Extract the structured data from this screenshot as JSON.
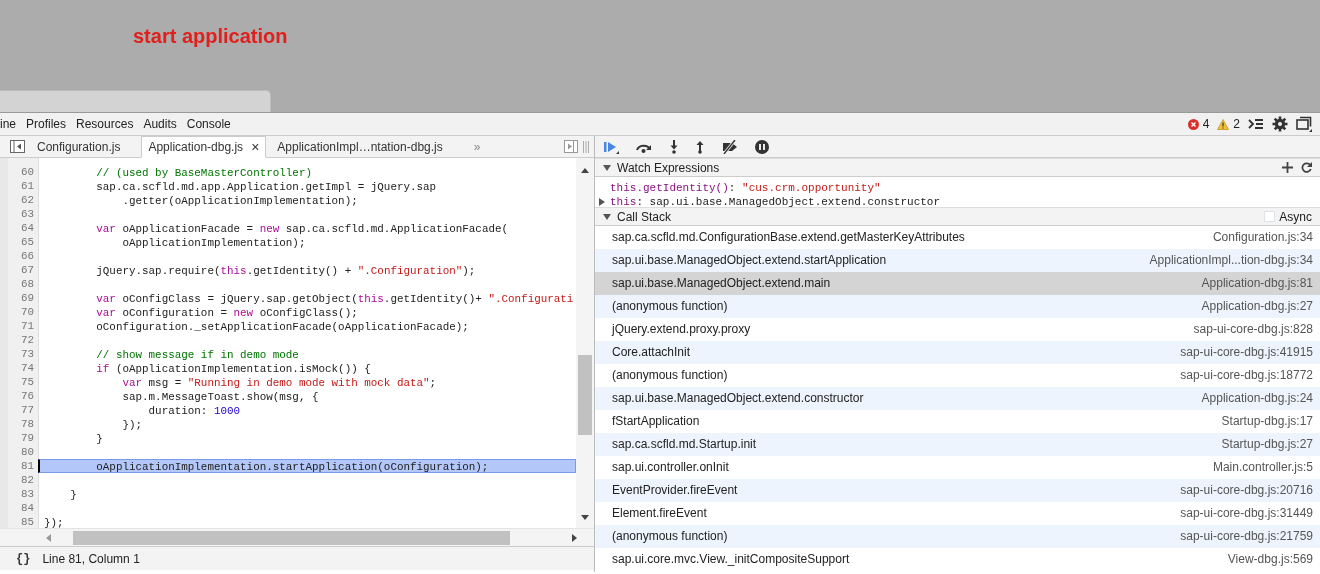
{
  "page": {
    "heading": "start application"
  },
  "devtools": {
    "panels": [
      {
        "label": "ine"
      },
      {
        "label": "Profiles"
      },
      {
        "label": "Resources"
      },
      {
        "label": "Audits"
      },
      {
        "label": "Console"
      }
    ],
    "error_count": "4",
    "warning_count": "2"
  },
  "sources": {
    "tabs": [
      {
        "label": "Configuration.js",
        "selected": false
      },
      {
        "label": "Application-dbg.js",
        "selected": true,
        "close": "×"
      },
      {
        "label": "ApplicationImpl…ntation-dbg.js",
        "selected": false
      }
    ],
    "more_tabs": "»",
    "lines": [
      {
        "number": "60",
        "highlighted": false,
        "tokens": [
          {
            "kind": "comment",
            "text": "        // (used by BaseMasterController)"
          }
        ]
      },
      {
        "number": "61",
        "highlighted": false,
        "tokens": [
          {
            "kind": "plain",
            "text": "        sap.ca.scfld.md.app.Application.getImpl = jQuery.sap"
          }
        ]
      },
      {
        "number": "62",
        "highlighted": false,
        "tokens": [
          {
            "kind": "plain",
            "text": "            .getter(oApplicationImplementation);"
          }
        ]
      },
      {
        "number": "63",
        "highlighted": false
      },
      {
        "number": "64",
        "highlighted": false,
        "tokens": [
          {
            "kind": "keyword",
            "text": "        var"
          },
          {
            "kind": "plain",
            "text": " oApplicationFacade = "
          },
          {
            "kind": "keyword",
            "text": "new"
          },
          {
            "kind": "plain",
            "text": " sap.ca.scfld.md.ApplicationFacade("
          }
        ]
      },
      {
        "number": "65",
        "highlighted": false,
        "tokens": [
          {
            "kind": "plain",
            "text": "            oApplicationImplementation);"
          }
        ]
      },
      {
        "number": "66",
        "highlighted": false
      },
      {
        "number": "67",
        "highlighted": false,
        "tokens": [
          {
            "kind": "plain",
            "text": "        jQuery.sap.require("
          },
          {
            "kind": "keyword",
            "text": "this"
          },
          {
            "kind": "plain",
            "text": ".getIdentity() + "
          },
          {
            "kind": "string",
            "text": "\".Configuration\""
          },
          {
            "kind": "plain",
            "text": ");"
          }
        ]
      },
      {
        "number": "68",
        "highlighted": false
      },
      {
        "number": "69",
        "highlighted": false,
        "tokens": [
          {
            "kind": "keyword",
            "text": "        var"
          },
          {
            "kind": "plain",
            "text": " oConfigClass = jQuery.sap.getObject("
          },
          {
            "kind": "keyword",
            "text": "this"
          },
          {
            "kind": "plain",
            "text": ".getIdentity()+ "
          },
          {
            "kind": "string",
            "text": "\".Configurati"
          }
        ]
      },
      {
        "number": "70",
        "highlighted": false,
        "tokens": [
          {
            "kind": "keyword",
            "text": "        var"
          },
          {
            "kind": "plain",
            "text": " oConfiguration = "
          },
          {
            "kind": "keyword",
            "text": "new"
          },
          {
            "kind": "plain",
            "text": " oConfigClass();"
          }
        ]
      },
      {
        "number": "71",
        "highlighted": false,
        "tokens": [
          {
            "kind": "plain",
            "text": "        oConfiguration._setApplicationFacade(oApplicationFacade);"
          }
        ]
      },
      {
        "number": "72",
        "highlighted": false
      },
      {
        "number": "73",
        "highlighted": false,
        "tokens": [
          {
            "kind": "comment",
            "text": "        // show message if in demo mode"
          }
        ]
      },
      {
        "number": "74",
        "highlighted": false,
        "tokens": [
          {
            "kind": "keyword",
            "text": "        if"
          },
          {
            "kind": "plain",
            "text": " (oApplicationImplementation.isMock()) {"
          }
        ]
      },
      {
        "number": "75",
        "highlighted": false,
        "tokens": [
          {
            "kind": "keyword",
            "text": "            var"
          },
          {
            "kind": "plain",
            "text": " msg = "
          },
          {
            "kind": "string",
            "text": "\"Running in demo mode with mock data\""
          },
          {
            "kind": "plain",
            "text": ";"
          }
        ]
      },
      {
        "number": "76",
        "highlighted": false,
        "tokens": [
          {
            "kind": "plain",
            "text": "            sap.m.MessageToast.show(msg, {"
          }
        ]
      },
      {
        "number": "77",
        "highlighted": false,
        "tokens": [
          {
            "kind": "plain",
            "text": "                duration: "
          },
          {
            "kind": "number",
            "text": "1000"
          }
        ]
      },
      {
        "number": "78",
        "highlighted": false,
        "tokens": [
          {
            "kind": "plain",
            "text": "            });"
          }
        ]
      },
      {
        "number": "79",
        "highlighted": false,
        "tokens": [
          {
            "kind": "plain",
            "text": "        }"
          }
        ]
      },
      {
        "number": "80",
        "highlighted": false
      },
      {
        "number": "81",
        "highlighted": true,
        "tokens": [
          {
            "kind": "plain",
            "text": "        oApplicationImplementation.startApplication(oConfiguration);"
          }
        ]
      },
      {
        "number": "82",
        "highlighted": false
      },
      {
        "number": "83",
        "highlighted": false,
        "tokens": [
          {
            "kind": "plain",
            "text": "    }"
          }
        ]
      },
      {
        "number": "84",
        "highlighted": false
      },
      {
        "number": "85",
        "highlighted": false,
        "tokens": [
          {
            "kind": "plain",
            "text": "});"
          }
        ]
      }
    ],
    "format_button": "{}",
    "status": "Line 81, Column 1"
  },
  "watch": {
    "title": "Watch Expressions",
    "expanded": true,
    "items": [
      {
        "expression": "this.getIdentity()",
        "separator": ": ",
        "value": "\"cus.crm.opportunity\"",
        "kind": "string",
        "expandable": false
      },
      {
        "expression": "this",
        "separator": ": ",
        "value": "sap.ui.base.ManagedObject.extend.constructor",
        "kind": "object",
        "expandable": true
      }
    ]
  },
  "call_stack": {
    "title": "Call Stack",
    "expanded": true,
    "async_label": "Async",
    "async_checked": false,
    "frames": [
      {
        "function": "sap.ca.scfld.md.ConfigurationBase.extend.getMasterKeyAttributes",
        "location": "Configuration.js:34",
        "selected": false
      },
      {
        "function": "sap.ui.base.ManagedObject.extend.startApplication",
        "location": "ApplicationImpl...tion-dbg.js:34",
        "selected": false
      },
      {
        "function": "sap.ui.base.ManagedObject.extend.main",
        "location": "Application-dbg.js:81",
        "selected": true
      },
      {
        "function": "(anonymous function)",
        "location": "Application-dbg.js:27",
        "selected": false
      },
      {
        "function": "jQuery.extend.proxy.proxy",
        "location": "sap-ui-core-dbg.js:828",
        "selected": false
      },
      {
        "function": "Core.attachInit",
        "location": "sap-ui-core-dbg.js:41915",
        "selected": false
      },
      {
        "function": "(anonymous function)",
        "location": "sap-ui-core-dbg.js:18772",
        "selected": false
      },
      {
        "function": "sap.ui.base.ManagedObject.extend.constructor",
        "location": "Application-dbg.js:24",
        "selected": false
      },
      {
        "function": "fStartApplication",
        "location": "Startup-dbg.js:17",
        "selected": false
      },
      {
        "function": "sap.ca.scfld.md.Startup.init",
        "location": "Startup-dbg.js:27",
        "selected": false
      },
      {
        "function": "sap.ui.controller.onInit",
        "location": "Main.controller.js:5",
        "selected": false
      },
      {
        "function": "EventProvider.fireEvent",
        "location": "sap-ui-core-dbg.js:20716",
        "selected": false
      },
      {
        "function": "Element.fireEvent",
        "location": "sap-ui-core-dbg.js:31449",
        "selected": false
      },
      {
        "function": "(anonymous function)",
        "location": "sap-ui-core-dbg.js:21759",
        "selected": false
      },
      {
        "function": "sap.ui.core.mvc.View._initCompositeSupport",
        "location": "View-dbg.js:569",
        "selected": false
      }
    ]
  }
}
